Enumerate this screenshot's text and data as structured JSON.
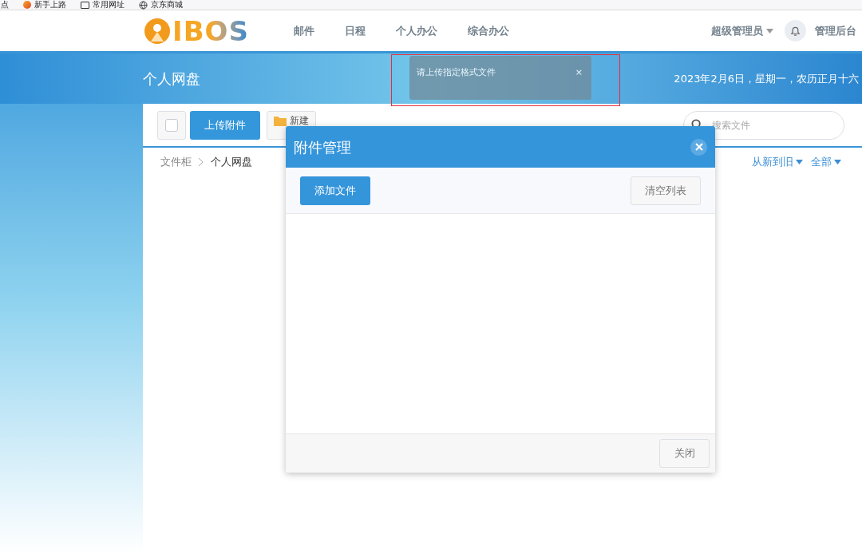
{
  "bookmarks": [
    {
      "kind": "plain",
      "label": "点"
    },
    {
      "kind": "badge",
      "label": "新手上路"
    },
    {
      "kind": "folder",
      "label": "常用网址"
    },
    {
      "kind": "globe",
      "label": "京东商城"
    }
  ],
  "header": {
    "logo": "IBOS",
    "nav": [
      {
        "label": "邮件"
      },
      {
        "label": "日程"
      },
      {
        "label": "个人办公"
      },
      {
        "label": "综合办公"
      }
    ],
    "user": "超级管理员",
    "admin_link": "管理后台"
  },
  "page": {
    "title": "个人网盘",
    "date": "2023年2月6日，星期一，农历正月十六"
  },
  "toast": {
    "message": "请上传指定格式文件",
    "close": "×",
    "highlighted": true
  },
  "toolbar": {
    "select_all_checked": false,
    "upload": "上传附件",
    "new": "新建",
    "search_placeholder": "搜索文件"
  },
  "breadcrumb": [
    "文件柜",
    "个人网盘"
  ],
  "sort": "从新到旧",
  "filter": "全部",
  "modal": {
    "title": "附件管理",
    "add": "添加文件",
    "clear": "清空列表",
    "close": "关闭"
  }
}
